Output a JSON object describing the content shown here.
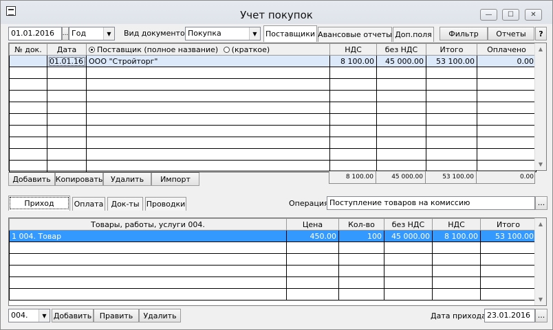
{
  "window": {
    "title": "Учет покупок",
    "controls": {
      "minimize": "—",
      "maximize": "☐",
      "close": "✕"
    }
  },
  "toolbar": {
    "date_from": "01.01.2016",
    "date_picker_button": "...",
    "period": "Год",
    "doc_type_label": "Вид документов",
    "doc_type": "Покупка",
    "tabs": [
      "Поставщики",
      "Авансовые отчеты",
      "Доп.поля"
    ],
    "filter_button": "Фильтр",
    "reports_button": "Отчеты",
    "help_button": "?"
  },
  "documents_grid": {
    "headers": {
      "doc_no": "№ док.",
      "date": "Дата",
      "supplier_full": "Поставщик (полное название)",
      "supplier_short": "(краткое)",
      "vat": "НДС",
      "no_vat": "без НДС",
      "total": "Итого",
      "paid": "Оплачено"
    },
    "rows": [
      {
        "doc_no": "",
        "date": "01.01.16",
        "supplier": "ООО \"Стройторг\"",
        "vat": "8 100.00",
        "no_vat": "45 000.00",
        "total": "53 100.00",
        "paid": "0.00"
      }
    ],
    "totals": {
      "vat": "8 100.00",
      "no_vat": "45 000.00",
      "total": "53 100.00",
      "paid": "0.00"
    },
    "buttons": {
      "add": "Добавить",
      "copy": "Копировать",
      "delete": "Удалить",
      "import": "Импорт"
    }
  },
  "detail": {
    "tabs": [
      "Приход",
      "Оплата",
      "Док-ты",
      "Проводки"
    ],
    "operation_label": "Операция",
    "operation_value": "Поступление товаров на комиссию",
    "operation_button": "...",
    "headers": {
      "goods": "Товары, работы, услуги 004.",
      "price": "Цена",
      "qty": "Кол-во",
      "no_vat": "без НДС",
      "vat": "НДС",
      "total": "Итого"
    },
    "rows": [
      {
        "goods": "1 004. Товар",
        "price": "450.00",
        "qty": "100",
        "no_vat": "45 000.00",
        "vat": "8 100.00",
        "total": "53 100.00"
      }
    ],
    "account": "004.",
    "buttons": {
      "add": "Добавить",
      "edit": "Править",
      "delete": "Удалить"
    },
    "receipt_date_label": "Дата прихода",
    "receipt_date": "23.01.2016",
    "receipt_date_button": "..."
  }
}
